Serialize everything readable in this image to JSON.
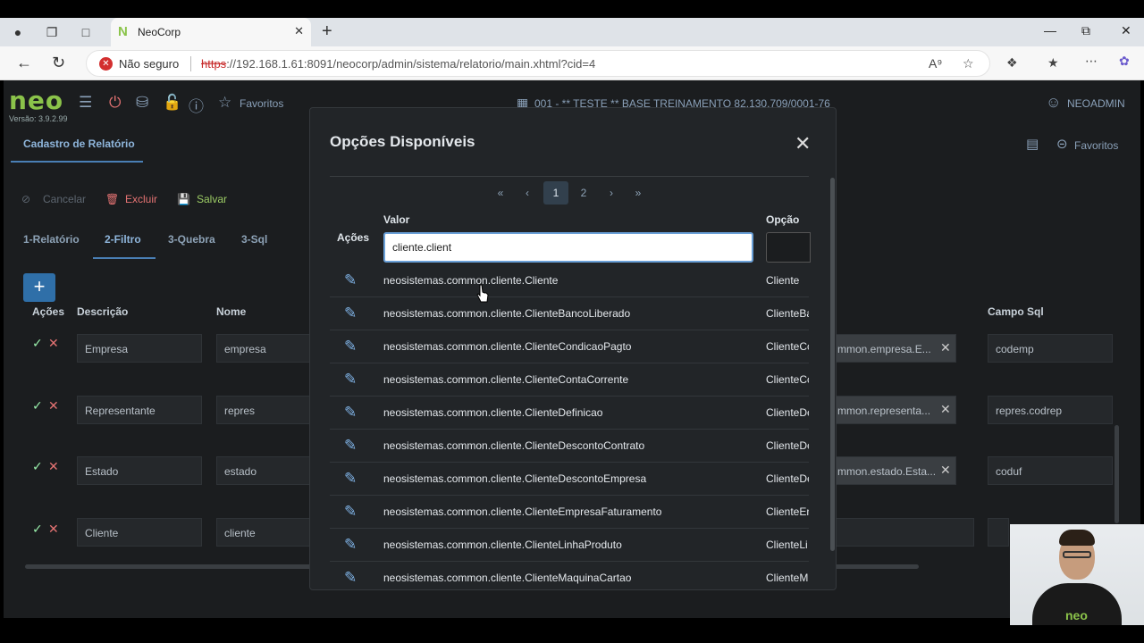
{
  "browser": {
    "tab_title": "NeoCorp",
    "security_label": "Não seguro",
    "url_scheme": "https",
    "url_rest": "://192.168.1.61:8091/neocorp/admin/sistema/relatorio/main.xhtml?cid=4"
  },
  "app": {
    "logo": "neo",
    "version": "Versão: 3.9.2.99",
    "favoritos": "Favoritos",
    "company": "001 - ** TESTE ** BASE TREINAMENTO 82.130.709/0001-76",
    "user": "NEOADMIN",
    "section_tab": "Cadastro de Relatório",
    "favoritos_right": "Favoritos",
    "toolbar": {
      "cancelar": "Cancelar",
      "excluir": "Excluir",
      "salvar": "Salvar"
    },
    "tabs": [
      "1-Relatório",
      "2-Filtro",
      "3-Quebra",
      "3-Sql"
    ],
    "columns": {
      "acoes": "Ações",
      "descricao": "Descrição",
      "nome": "Nome",
      "campo_sql": "Campo Sql"
    },
    "rows": [
      {
        "descricao": "Empresa",
        "nome": "empresa",
        "classe": "mmon.empresa.E...",
        "campo_sql": "codemp"
      },
      {
        "descricao": "Representante",
        "nome": "repres",
        "classe": "mmon.representa...",
        "campo_sql": "repres.codrep"
      },
      {
        "descricao": "Estado",
        "nome": "estado",
        "classe": "mmon.estado.Esta...",
        "campo_sql": "coduf"
      },
      {
        "descricao": "Cliente",
        "nome": "cliente",
        "classe": "",
        "campo_sql": ""
      }
    ]
  },
  "modal": {
    "title": "Opções Disponíveis",
    "pages": [
      "1",
      "2"
    ],
    "current_page": "1",
    "headers": {
      "acoes": "Ações",
      "valor": "Valor",
      "opcao": "Opção"
    },
    "filter_value": "cliente.client",
    "rows": [
      {
        "valor": "neosistemas.common.cliente.Cliente",
        "opcao": "Cliente"
      },
      {
        "valor": "neosistemas.common.cliente.ClienteBancoLiberado",
        "opcao": "ClienteBa"
      },
      {
        "valor": "neosistemas.common.cliente.ClienteCondicaoPagto",
        "opcao": "ClienteCo"
      },
      {
        "valor": "neosistemas.common.cliente.ClienteContaCorrente",
        "opcao": "ClienteCo"
      },
      {
        "valor": "neosistemas.common.cliente.ClienteDefinicao",
        "opcao": "ClienteDe"
      },
      {
        "valor": "neosistemas.common.cliente.ClienteDescontoContrato",
        "opcao": "ClienteDe"
      },
      {
        "valor": "neosistemas.common.cliente.ClienteDescontoEmpresa",
        "opcao": "ClienteDe"
      },
      {
        "valor": "neosistemas.common.cliente.ClienteEmpresaFaturamento",
        "opcao": "ClienteEr"
      },
      {
        "valor": "neosistemas.common.cliente.ClienteLinhaProduto",
        "opcao": "ClienteLi"
      },
      {
        "valor": "neosistemas.common.cliente.ClienteMaquinaCartao",
        "opcao": "ClienteM"
      }
    ]
  },
  "webcam": {
    "shirt_logo": "neo"
  },
  "colors": {
    "brand": "#8bc34a",
    "accent": "#4a7fb5",
    "primary_button": "#2f6fa8"
  }
}
